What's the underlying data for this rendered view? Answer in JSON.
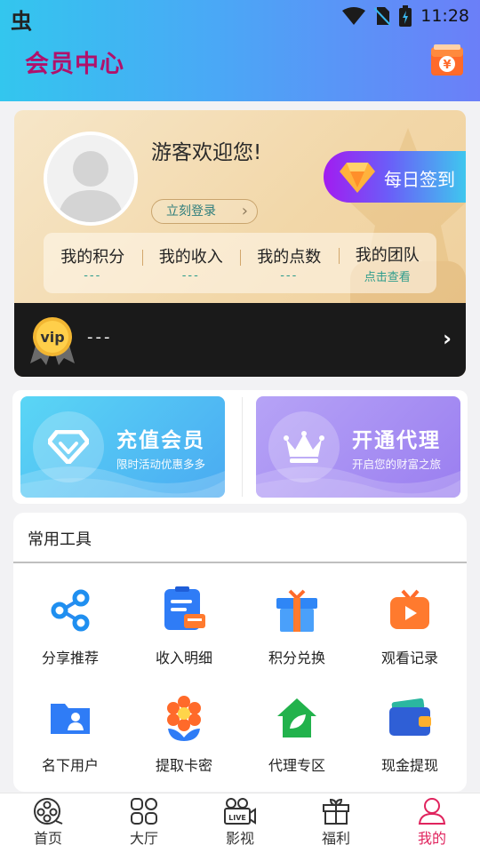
{
  "status_bar": {
    "app_glyph": "虫",
    "time": "11:28"
  },
  "header": {
    "title": "会员中心",
    "wallet_icon": "wallet-yen-icon",
    "wallet_glyph": "¥"
  },
  "user_card": {
    "welcome": "游客欢迎您!",
    "login_label": "立刻登录",
    "checkin_label": "每日签到",
    "stats": [
      {
        "label": "我的积分",
        "value": "---"
      },
      {
        "label": "我的收入",
        "value": "---"
      },
      {
        "label": "我的点数",
        "value": "---"
      },
      {
        "label": "我的团队",
        "value": "点击查看"
      }
    ],
    "vip": {
      "badge_text": "vip",
      "status": "---"
    }
  },
  "promo": {
    "recharge": {
      "title": "充值会员",
      "subtitle": "限时活动优惠多多"
    },
    "agent": {
      "title": "开通代理",
      "subtitle": "开启您的财富之旅"
    }
  },
  "tools": {
    "title": "常用工具",
    "items": [
      {
        "label": "分享推荐",
        "icon": "share-icon"
      },
      {
        "label": "收入明细",
        "icon": "income-detail-icon"
      },
      {
        "label": "积分兑换",
        "icon": "gift-box-icon"
      },
      {
        "label": "观看记录",
        "icon": "tv-play-icon"
      },
      {
        "label": "名下用户",
        "icon": "user-folder-icon"
      },
      {
        "label": "提取卡密",
        "icon": "flower-icon"
      },
      {
        "label": "代理专区",
        "icon": "house-leaf-icon"
      },
      {
        "label": "现金提现",
        "icon": "wallet-icon"
      }
    ]
  },
  "tabbar": [
    {
      "label": "首页",
      "icon": "film-reel-icon"
    },
    {
      "label": "大厅",
      "icon": "grid-icon"
    },
    {
      "label": "影视",
      "icon": "live-camera-icon",
      "icon_text": "LIVE"
    },
    {
      "label": "福利",
      "icon": "gift-icon"
    },
    {
      "label": "我的",
      "icon": "profile-icon",
      "active": true
    }
  ],
  "colors": {
    "accent": "#e0245e",
    "title": "#b0116b",
    "teal": "#2d9c8c"
  }
}
